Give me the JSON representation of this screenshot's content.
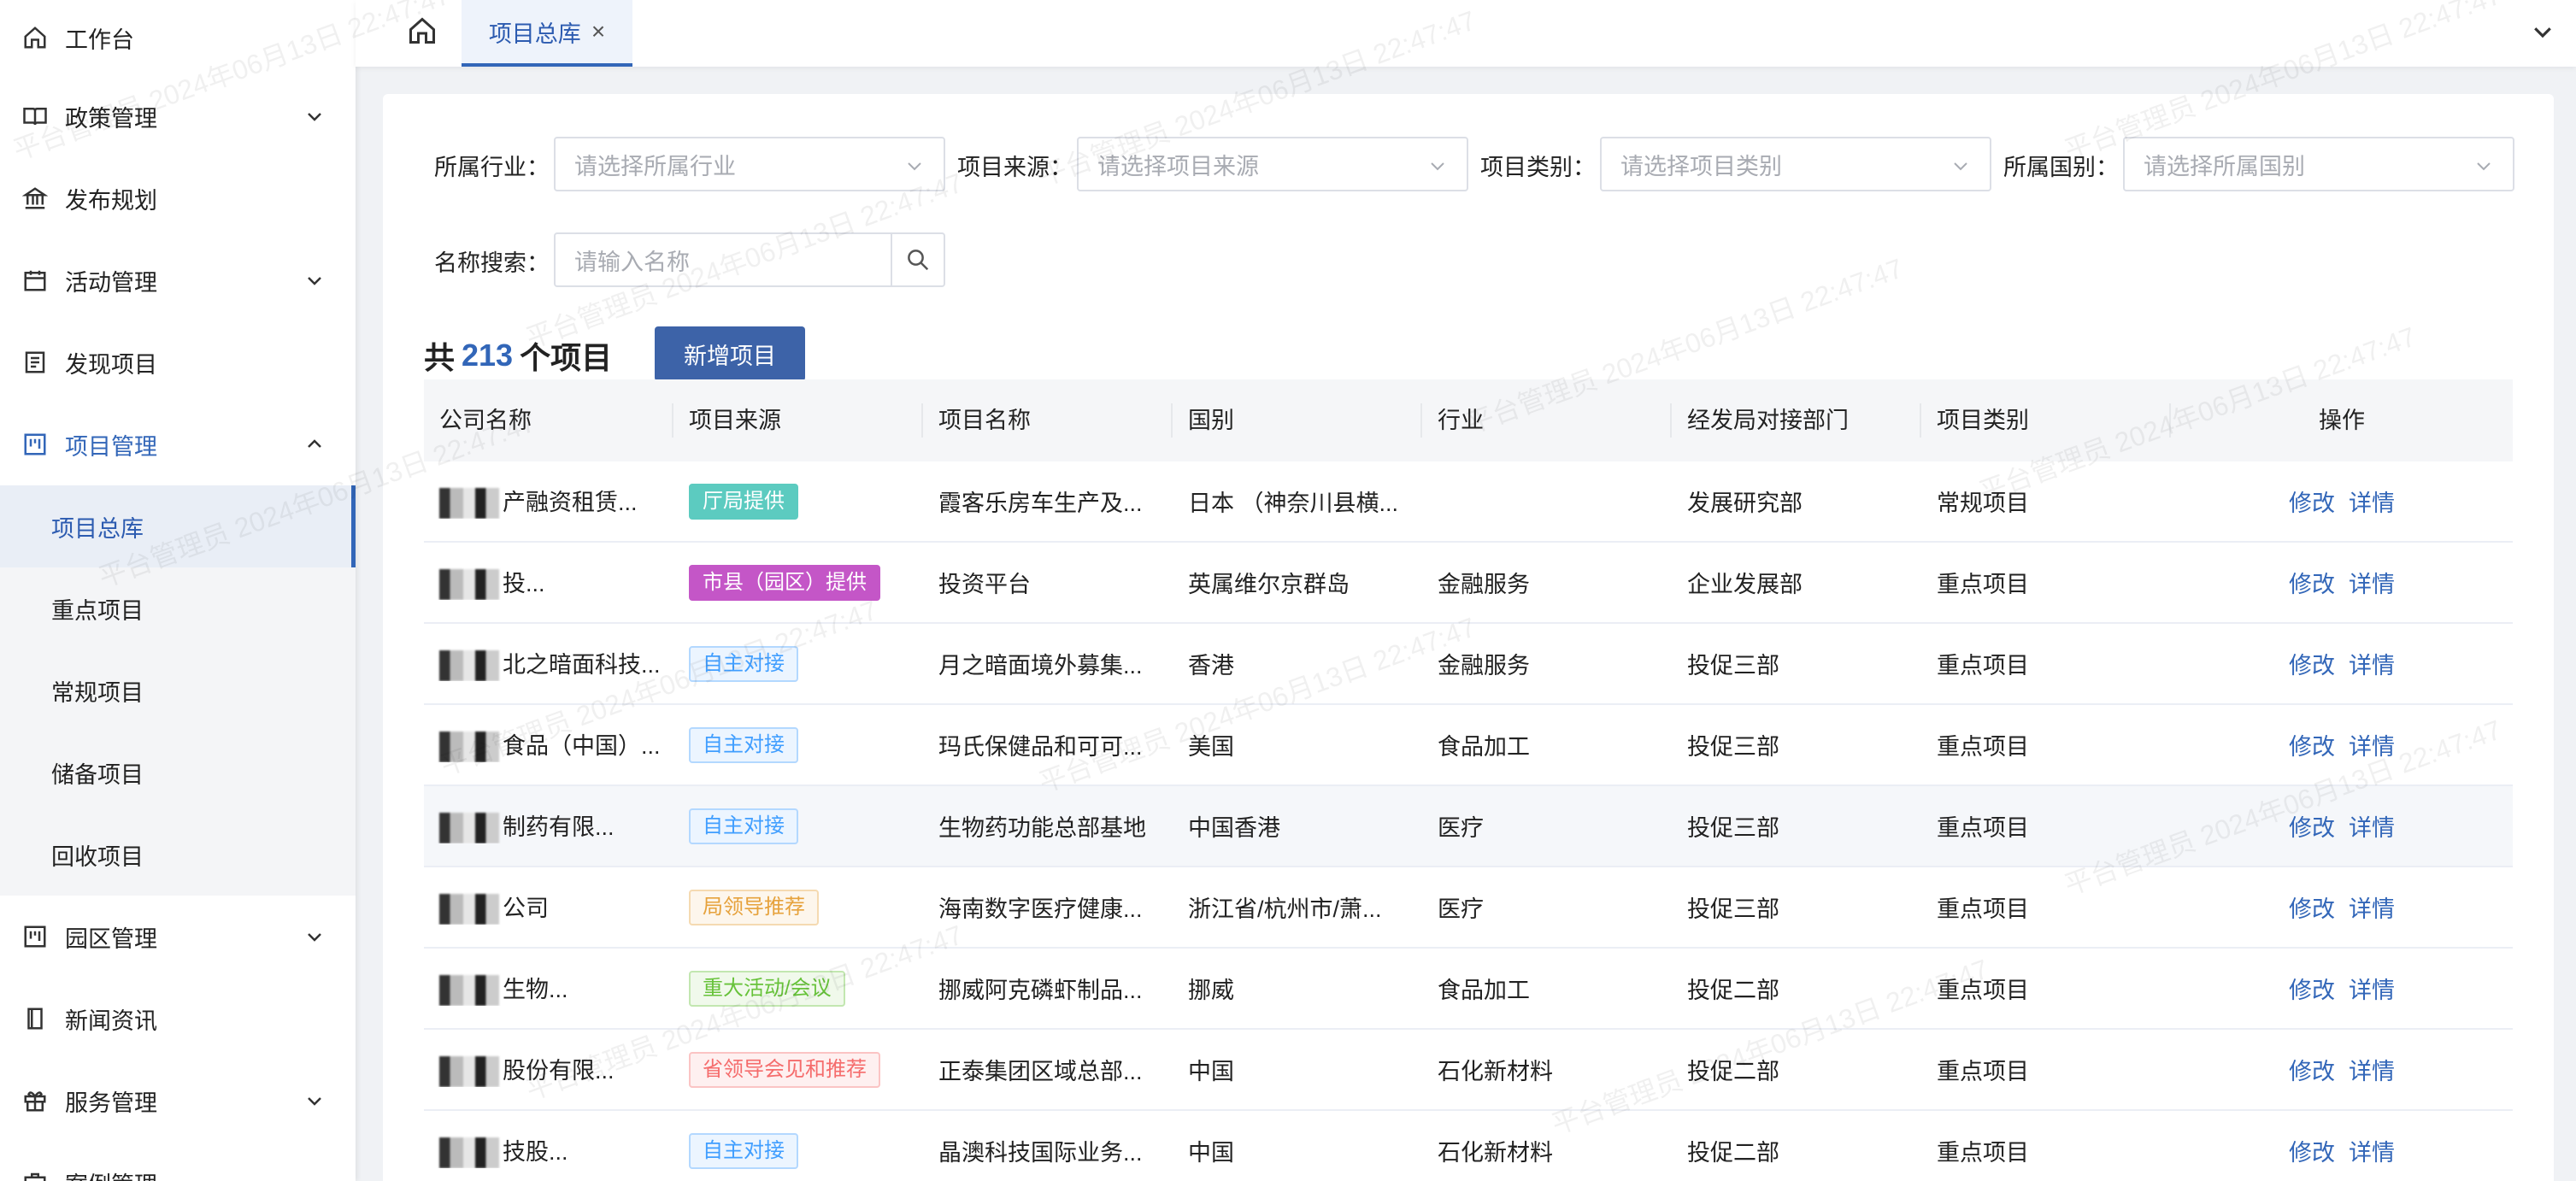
{
  "sidebar": {
    "items": [
      {
        "label": "工作台",
        "icon": "home-icon"
      },
      {
        "label": "政策管理",
        "icon": "book-icon"
      },
      {
        "label": "发布规划",
        "icon": "bank-icon"
      },
      {
        "label": "活动管理",
        "icon": "calendar-icon"
      },
      {
        "label": "发现项目",
        "icon": "list-icon"
      },
      {
        "label": "项目管理",
        "icon": "board-icon"
      },
      {
        "label": "园区管理",
        "icon": "board-icon"
      },
      {
        "label": "新闻资讯",
        "icon": "document-icon"
      },
      {
        "label": "服务管理",
        "icon": "gift-icon"
      },
      {
        "label": "案例管理",
        "icon": "case-icon"
      }
    ],
    "project_subitems": [
      "项目总库",
      "重点项目",
      "常规项目",
      "储备项目",
      "回收项目"
    ]
  },
  "tabs": {
    "active_label": "项目总库",
    "close": "×"
  },
  "filters": {
    "industry_label": "所属行业：",
    "industry_placeholder": "请选择所属行业",
    "source_label": "项目来源：",
    "source_placeholder": "请选择项目来源",
    "category_label": "项目类别：",
    "category_placeholder": "请选择项目类别",
    "country_label": "所属国别：",
    "country_placeholder": "请选择所属国别",
    "name_label": "名称搜索：",
    "name_placeholder": "请输入名称"
  },
  "summary": {
    "prefix": "共",
    "count": "213",
    "suffix": "个项目",
    "add_button": "新增项目"
  },
  "table": {
    "headers": [
      "公司名称",
      "项目来源",
      "项目名称",
      "国别",
      "行业",
      "经发局对接部门",
      "项目类别",
      "操作"
    ],
    "edit_label": "修改",
    "detail_label": "详情",
    "rows": [
      {
        "company": "产融资租赁...",
        "source": "厅局提供",
        "tag": "teal",
        "name": "霞客乐房车生产及...",
        "country": "日本 （神奈川县横...",
        "industry": "",
        "dept": "发展研究部",
        "category": "常规项目"
      },
      {
        "company": "投...",
        "source": "市县（园区）提供",
        "tag": "purple",
        "name": "投资平台",
        "country": "英属维尔京群岛",
        "industry": "金融服务",
        "dept": "企业发展部",
        "category": "重点项目"
      },
      {
        "company": "北之暗面科技...",
        "source": "自主对接",
        "tag": "blue",
        "name": "月之暗面境外募集...",
        "country": "香港",
        "industry": "金融服务",
        "dept": "投促三部",
        "category": "重点项目"
      },
      {
        "company": "食品（中国）...",
        "source": "自主对接",
        "tag": "blue",
        "name": "玛氏保健品和可可...",
        "country": "美国",
        "industry": "食品加工",
        "dept": "投促三部",
        "category": "重点项目"
      },
      {
        "company": "制药有限...",
        "source": "自主对接",
        "tag": "blue",
        "name": "生物药功能总部基地",
        "country": "中国香港",
        "industry": "医疗",
        "dept": "投促三部",
        "category": "重点项目"
      },
      {
        "company": "公司",
        "source": "局领导推荐",
        "tag": "orange",
        "name": "海南数字医疗健康...",
        "country": "浙江省/杭州市/萧...",
        "industry": "医疗",
        "dept": "投促三部",
        "category": "重点项目"
      },
      {
        "company": "生物...",
        "source": "重大活动/会议",
        "tag": "green",
        "name": "挪威阿克磷虾制品...",
        "country": "挪威",
        "industry": "食品加工",
        "dept": "投促二部",
        "category": "重点项目"
      },
      {
        "company": "股份有限...",
        "source": "省领导会见和推荐",
        "tag": "red",
        "name": "正泰集团区域总部...",
        "country": "中国",
        "industry": "石化新材料",
        "dept": "投促二部",
        "category": "重点项目"
      },
      {
        "company": "技股...",
        "source": "自主对接",
        "tag": "blue",
        "name": "晶澳科技国际业务...",
        "country": "中国",
        "industry": "石化新材料",
        "dept": "投促二部",
        "category": "重点项目"
      }
    ]
  },
  "watermark": "平台管理员 2024年06月13日 22:47:47",
  "colors": {
    "accent": "#3266b8",
    "button": "#3d63a8"
  }
}
